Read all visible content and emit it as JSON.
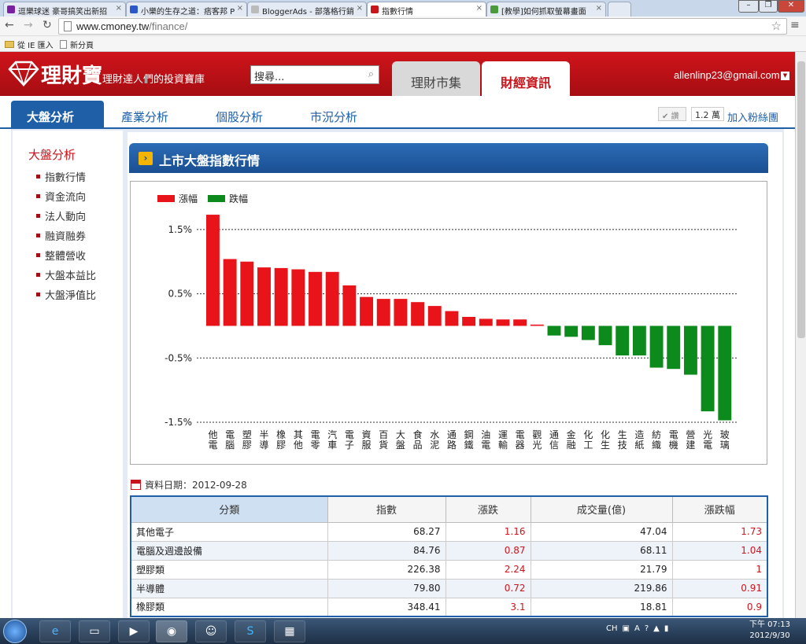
{
  "browser": {
    "tabs": [
      {
        "title": "逗樂球迷 豪哥搞笑出新招",
        "color": "#7a1fa2"
      },
      {
        "title": "小樂的生存之道：痞客邦 P",
        "color": "#2a58c9"
      },
      {
        "title": "BloggerAds - 部落格行銷",
        "color": "#999999"
      },
      {
        "title": "指數行情",
        "color": "#c8141a"
      },
      {
        "title": "[教學]如何抓取螢幕畫面",
        "color": "#4a9a3c"
      }
    ],
    "url_host": "www.cmoney.tw",
    "url_path": "/finance/",
    "bookmarks": [
      "從 IE 匯入",
      "新分頁"
    ]
  },
  "site": {
    "logo": "理財寶",
    "slogan": "理財達人們的投資寶庫",
    "search_placeholder": "搜尋...",
    "main_tabs": [
      "理財市集",
      "財經資訊"
    ],
    "user": "allenlinp23@gmail.com"
  },
  "subnav": {
    "tabs": [
      "大盤分析",
      "產業分析",
      "個股分析",
      "市況分析"
    ],
    "like_label": "讚",
    "like_count": "1.2 萬",
    "fan_link": "加入粉絲團"
  },
  "sidebar": {
    "title": "大盤分析",
    "items": [
      "指數行情",
      "資金流向",
      "法人動向",
      "融資融券",
      "整體營收",
      "大盤本益比",
      "大盤淨值比"
    ]
  },
  "section": {
    "title": "上市大盤指數行情",
    "date_label": "資料日期：2012-09-28"
  },
  "chart_data": {
    "type": "bar",
    "legend": [
      {
        "name": "漲幅",
        "color": "#e8141a"
      },
      {
        "name": "跌幅",
        "color": "#0d8a1c"
      }
    ],
    "ylim": [
      -1.5,
      2.0
    ],
    "yticks": [
      "1.5%",
      "0.5%",
      "-0.5%",
      "-1.5%"
    ],
    "ytick_values": [
      1.5,
      0.5,
      -0.5,
      -1.5
    ],
    "categories": [
      "其他電子",
      "電腦",
      "塑膠",
      "半導",
      "橡膠",
      "其他",
      "電零",
      "汽車",
      "電子",
      "資服",
      "百貨",
      "大盤",
      "食品",
      "水泥",
      "通路",
      "鋼鐵",
      "油電",
      "運輸",
      "電器",
      "觀光",
      "通信",
      "金融",
      "化工",
      "化生",
      "生技",
      "造紙",
      "紡織",
      "電機",
      "營建",
      "光電",
      "玻璃"
    ],
    "x_label_chars": [
      "他電",
      "電腦",
      "塑膠",
      "半導",
      "橡膠",
      "其他",
      "電零",
      "汽車",
      "電子",
      "資服",
      "百貨",
      "大盤",
      "食品",
      "水泥",
      "通路",
      "鋼鐵",
      "油電",
      "運輸",
      "電器",
      "觀光",
      "通信",
      "金融",
      "化工",
      "化生",
      "生技",
      "造紙",
      "紡織",
      "電機",
      "營建",
      "光電",
      "玻璃"
    ],
    "values": [
      1.73,
      1.04,
      1.0,
      0.91,
      0.9,
      0.88,
      0.84,
      0.84,
      0.63,
      0.45,
      0.42,
      0.42,
      0.37,
      0.31,
      0.23,
      0.14,
      0.11,
      0.1,
      0.1,
      0.02,
      -0.15,
      -0.17,
      -0.22,
      -0.3,
      -0.46,
      -0.46,
      -0.65,
      -0.67,
      -0.76,
      -1.33,
      -1.47
    ]
  },
  "table": {
    "headers": [
      "分類",
      "指數",
      "漲跌",
      "成交量(億)",
      "漲跌幅"
    ],
    "rows": [
      [
        "其他電子",
        "68.27",
        "1.16",
        "47.04",
        "1.73"
      ],
      [
        "電腦及週邊設備",
        "84.76",
        "0.87",
        "68.11",
        "1.04"
      ],
      [
        "塑膠類",
        "226.38",
        "2.24",
        "21.79",
        "1"
      ],
      [
        "半導體",
        "79.80",
        "0.72",
        "219.86",
        "0.91"
      ],
      [
        "橡膠類",
        "348.41",
        "3.1",
        "18.81",
        "0.9"
      ]
    ]
  },
  "taskbar": {
    "lang": "CH",
    "time": "下午 07:13",
    "date": "2012/9/30"
  }
}
